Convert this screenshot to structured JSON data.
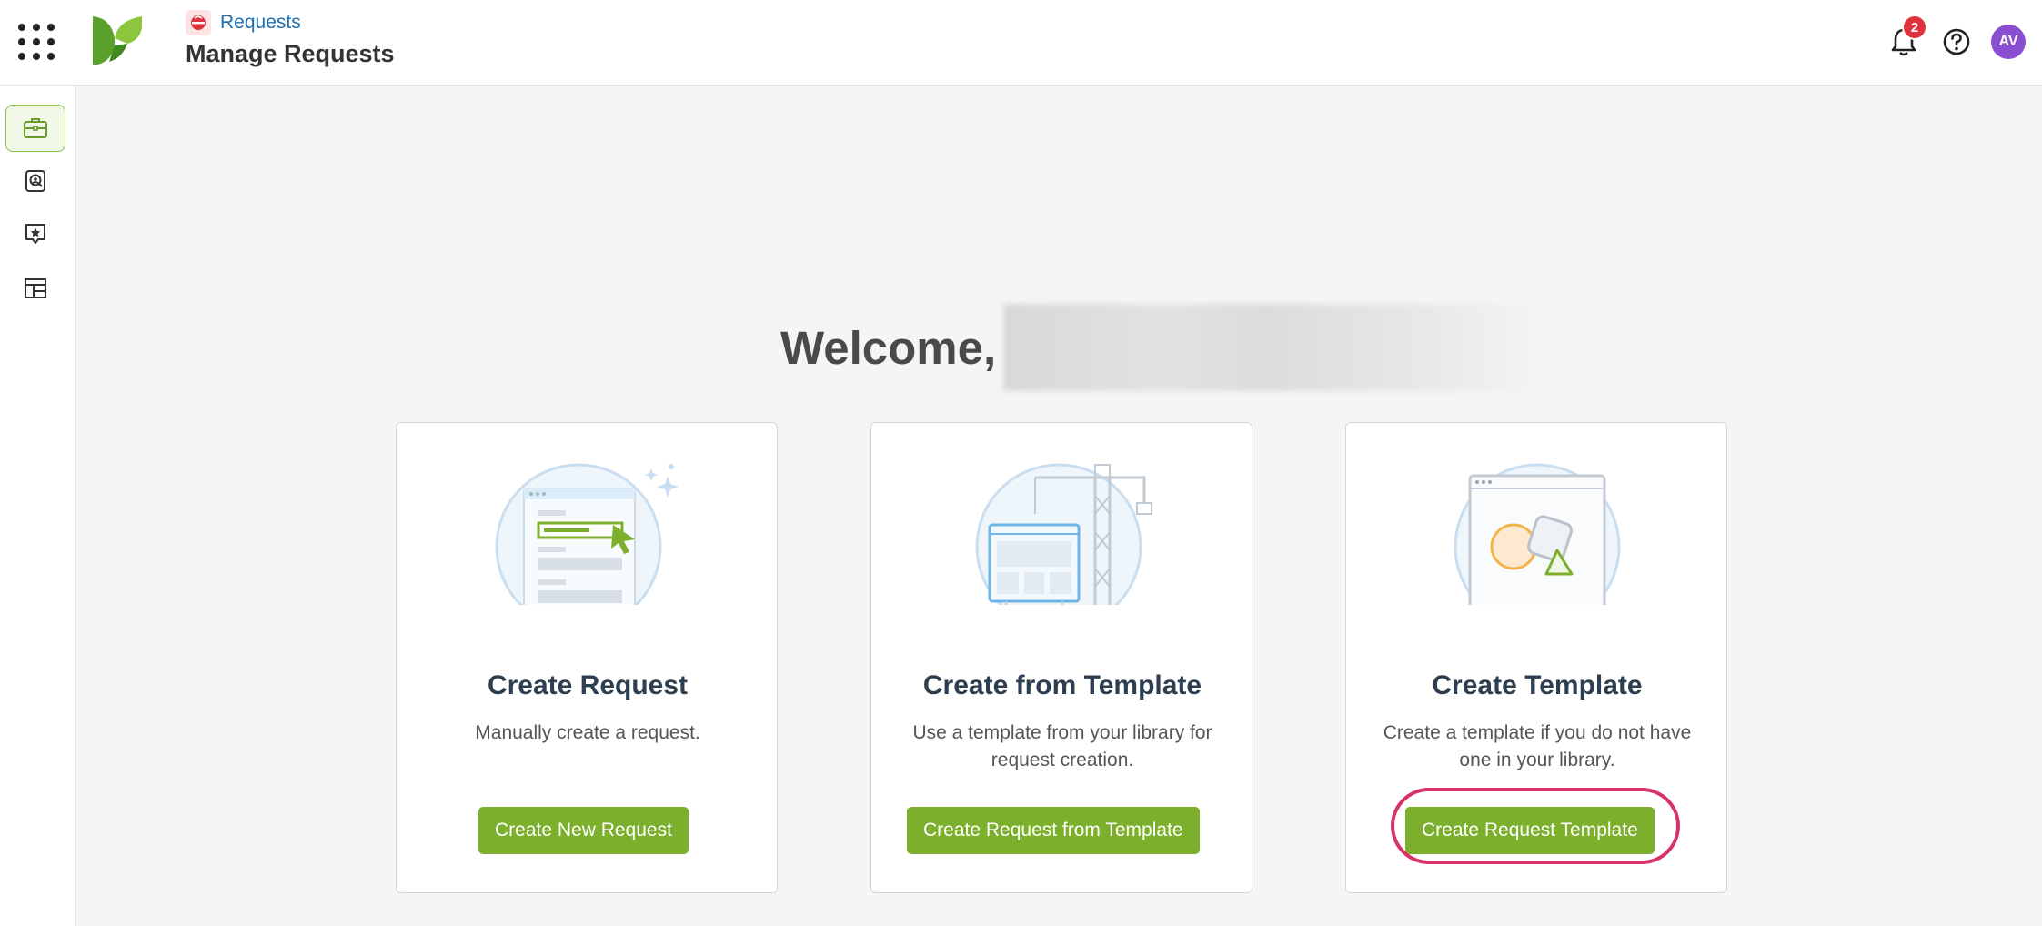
{
  "header": {
    "breadcrumb": "Requests",
    "page_title": "Manage Requests",
    "notifications_count": "2",
    "avatar_initials": "AV"
  },
  "sidebar": {
    "items": [
      {
        "name": "briefcase",
        "active": true
      },
      {
        "name": "contact-search",
        "active": false
      },
      {
        "name": "starred-message",
        "active": false
      },
      {
        "name": "layout",
        "active": false
      }
    ]
  },
  "main": {
    "welcome": "Welcome,",
    "cards": [
      {
        "title": "Create Request",
        "desc": "Manually create a request.",
        "button": "Create New Request"
      },
      {
        "title": "Create from Template",
        "desc": "Use a template from your library for request creation.",
        "button": "Create Request from Template"
      },
      {
        "title": "Create Template",
        "desc": "Create a template if you do not have one in your library.",
        "button": "Create Request Template"
      }
    ]
  },
  "colors": {
    "accent": "#7cb02c",
    "link": "#1f6fb0",
    "badge": "#e0323c",
    "avatar": "#8a4fd1",
    "highlight": "#d83266"
  }
}
